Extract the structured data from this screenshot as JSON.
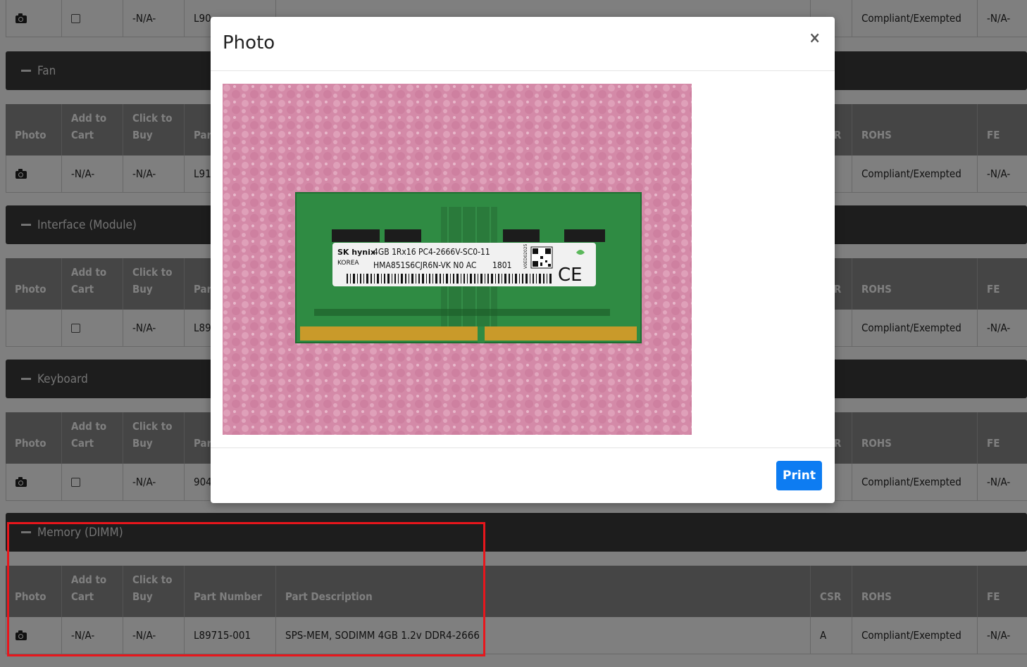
{
  "columns": {
    "photo": "Photo",
    "add_to_cart_1": "Add to",
    "add_to_cart_2": "Cart",
    "click_to_buy_1": "Click to",
    "click_to_buy_2": "Buy",
    "part_number": "Part Number",
    "part_description": "Part Description",
    "csr": "CSR",
    "rohs": "ROHS",
    "fe": "FE"
  },
  "sections": [
    {
      "title": "",
      "row": {
        "photo_icon": "camera-icon",
        "add_to_cart": "checkbox",
        "click_to_buy": "-N/A-",
        "part_number": "L90",
        "part_description": "",
        "csr": "",
        "rohs": "Compliant/Exempted",
        "fe": "-N/A-"
      }
    },
    {
      "title": "Fan",
      "row": {
        "photo_icon": "camera-icon",
        "add_to_cart": "-N/A-",
        "click_to_buy": "-N/A-",
        "part_number": "L91",
        "part_description": "",
        "csr": "",
        "rohs": "Compliant/Exempted",
        "fe": "-N/A-"
      }
    },
    {
      "title": "Interface (Module)",
      "row": {
        "photo_icon": "",
        "add_to_cart": "checkbox",
        "click_to_buy": "-N/A-",
        "part_number": "L89",
        "part_description": "",
        "csr": "",
        "rohs": "Compliant/Exempted",
        "fe": "-N/A-"
      }
    },
    {
      "title": "Keyboard",
      "row": {
        "photo_icon": "camera-icon",
        "add_to_cart": "checkbox",
        "click_to_buy": "-N/A-",
        "part_number": "904",
        "part_description": "",
        "csr": "",
        "rohs": "Compliant/Exempted",
        "fe": "-N/A-"
      }
    },
    {
      "title": "Memory (DIMM)",
      "row": {
        "photo_icon": "camera-icon",
        "add_to_cart": "-N/A-",
        "click_to_buy": "-N/A-",
        "part_number": "L89715-001",
        "part_description": "SPS-MEM, SODIMM 4GB 1.2v DDR4-2666",
        "csr": "A",
        "rohs": "Compliant/Exempted",
        "fe": "-N/A-"
      }
    }
  ],
  "modal": {
    "title": "Photo",
    "close_label": "×",
    "print_label": "Print",
    "dimm_label": {
      "brand": "SK hynix",
      "origin": "KOREA",
      "line1": "4GB 1Rx16 PC4-2666V-SC0-11",
      "line2": "HMA851S6CJR6N-VK N0 AC",
      "date": "1801",
      "ce": "CE",
      "qr_text": "V0ED02025"
    }
  },
  "colors": {
    "header_dark": "#3a3a3a",
    "header_gray": "#8a8a8a",
    "primary": "#0d7cf2",
    "highlight": "#e8161c"
  }
}
